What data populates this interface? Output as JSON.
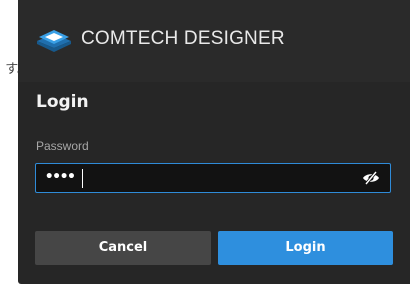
{
  "background": {
    "partial_text": "す。"
  },
  "header": {
    "brand": "COMTECH DESIGNER",
    "logo_icon": "layered-diamond-logo",
    "accent_color": "#3aa0e6"
  },
  "dialog": {
    "title": "Login",
    "password": {
      "label": "Password",
      "value_masked": "••••",
      "toggle_icon": "eye-slash-icon"
    },
    "buttons": {
      "cancel": "Cancel",
      "login": "Login"
    },
    "colors": {
      "login_button": "#2e8fde",
      "cancel_button": "#464646",
      "focus_border": "#2f8bd8"
    }
  }
}
